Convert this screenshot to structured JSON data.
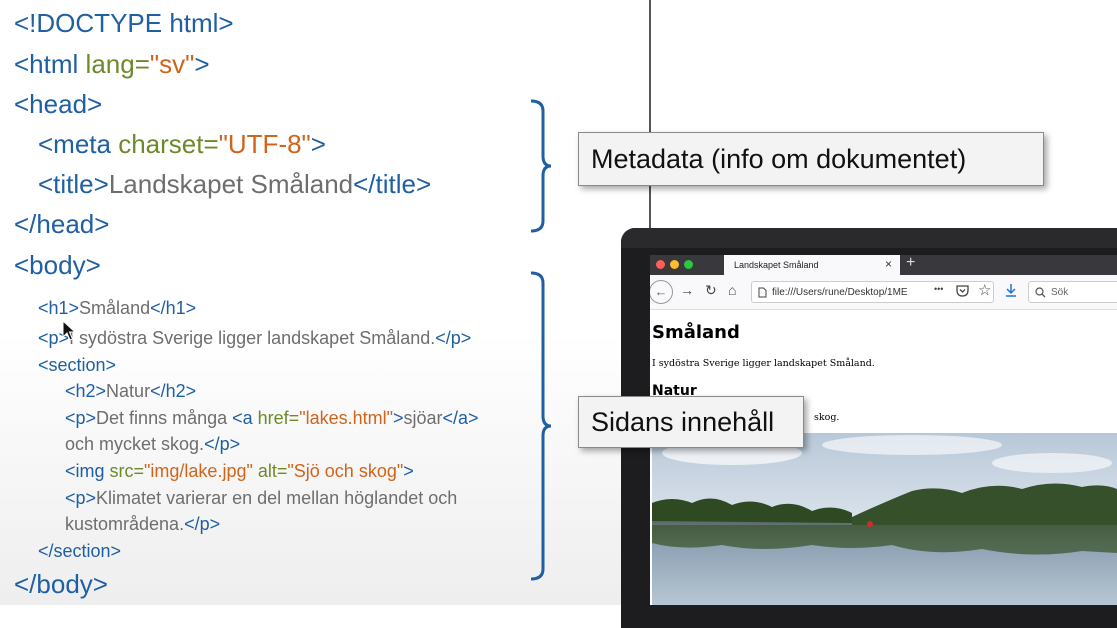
{
  "code": {
    "doctype": "<!DOCTYPE html>",
    "html_open": "<html",
    "html_lang_attr": " lang=",
    "html_lang_val": "\"sv\"",
    "gt": ">",
    "head_open": "<head>",
    "meta_open": "<meta",
    "meta_attr": " charset=",
    "meta_val": "\"UTF-8\"",
    "title_open": "<title>",
    "title_text": "Landskapet Småland",
    "title_close": "</title>",
    "head_close": "</head>",
    "body_open": "<body>",
    "h1_open": "<h1>",
    "h1_text": "Småland",
    "h1_close": "</h1>",
    "p_open": "<p>",
    "p1_text": "I sydöstra Sverige ligger landskapet Småland.",
    "p_close": "</p>",
    "section_open": "<section>",
    "h2_open": "<h2>",
    "h2_text": "Natur",
    "h2_close": "</h2>",
    "p2_text": "Det finns många ",
    "a_open": "<a",
    "a_attr": " href=",
    "a_val": "\"lakes.html\"",
    "a_text": "sjöar",
    "a_close": "</a>",
    "p2_cont": "och mycket skog.",
    "img_open": "<img",
    "img_src_attr": " src=",
    "img_src_val": "\"img/lake.jpg\"",
    "img_alt_attr": " alt=",
    "img_alt_val": "\"Sjö och skog\"",
    "p3_text": "Klimatet varierar en del mellan höglandet och",
    "p3_cont": "kustområdena.",
    "section_close": "</section>",
    "body_close": "</body>"
  },
  "callouts": {
    "metadata": "Metadata (info om dokumentet)",
    "content": "Sidans innehåll"
  },
  "browser": {
    "tab_title": "Landskapet Småland",
    "tab_close": "×",
    "new_tab": "+",
    "url": "file:///Users/rune/Desktop/1ME",
    "more_icon": "•••",
    "search_placeholder": "Sök",
    "page": {
      "h1": "Småland",
      "p1": "I sydöstra Sverige ligger landskapet Småland.",
      "h2": "Natur",
      "p2_visible_end": "skog."
    }
  },
  "colors": {
    "tag": "#1f5fa3",
    "attr": "#6d8a2a",
    "value": "#d0641a",
    "text": "#6e6e6e",
    "brace": "#1f5fa3"
  }
}
